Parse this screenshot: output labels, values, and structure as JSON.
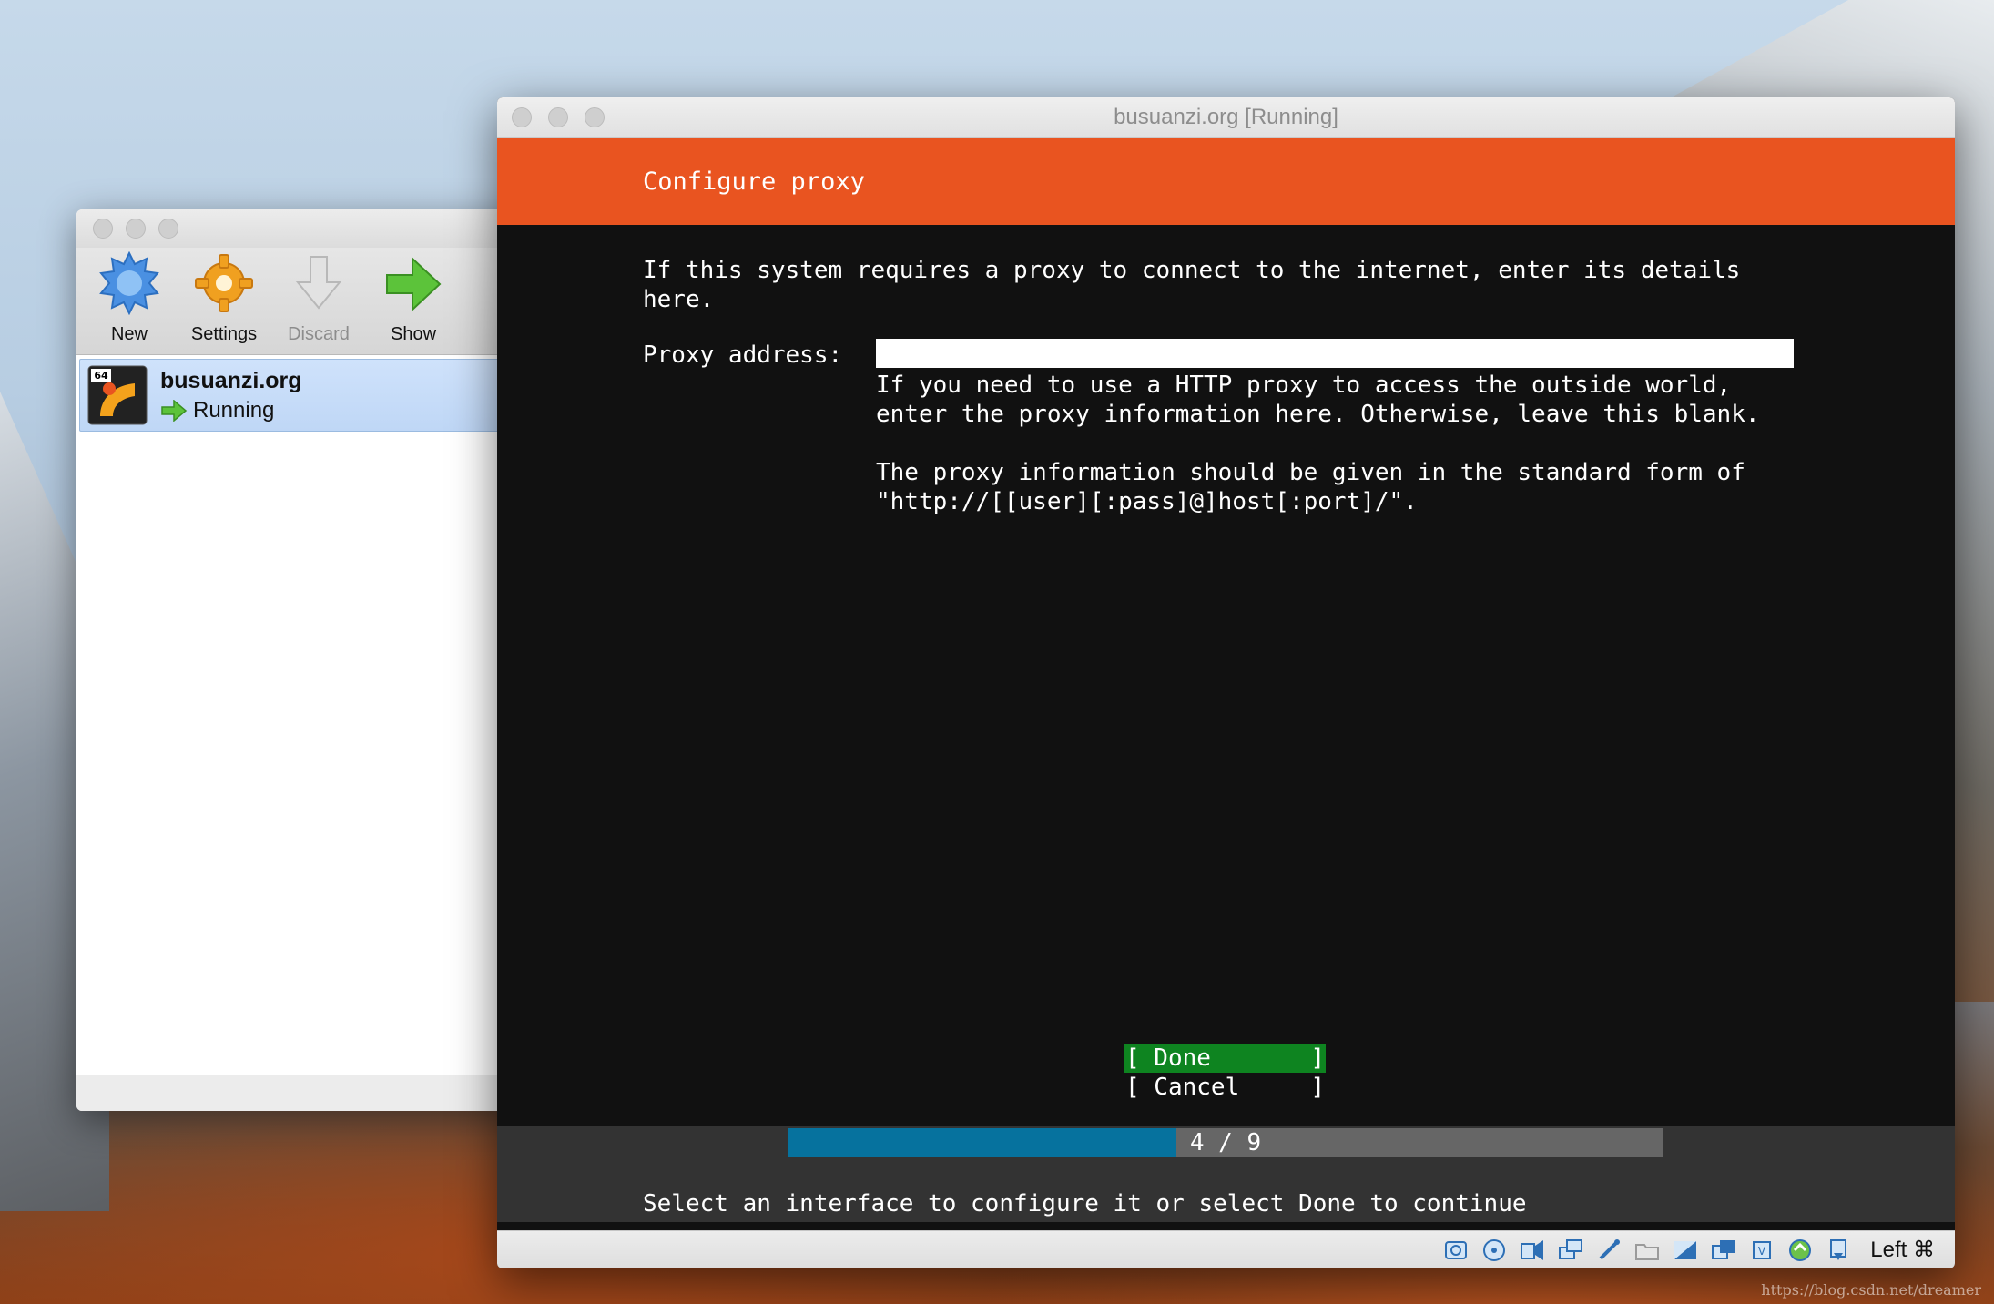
{
  "manager": {
    "toolbar": [
      {
        "label": "New",
        "icon": "new-icon"
      },
      {
        "label": "Settings",
        "icon": "settings-icon"
      },
      {
        "label": "Discard",
        "icon": "discard-icon"
      },
      {
        "label": "Show",
        "icon": "show-icon"
      }
    ],
    "vm": {
      "name": "busuanzi.org",
      "status": "Running",
      "os_badge": "64"
    }
  },
  "vm_window": {
    "title": "busuanzi.org [Running]",
    "screen": {
      "header": "Configure proxy",
      "intro": "If this system requires a proxy to connect to the internet, enter its details\nhere.",
      "proxy_label": "Proxy address:",
      "proxy_value": "",
      "help1": "If you need to use a HTTP proxy to access the outside world,\nenter the proxy information here. Otherwise, leave this blank.",
      "help2": "The proxy information should be given in the standard form of\n\"http://[[user][:pass]@]host[:port]/\".",
      "done_label": "[ Done       ]",
      "cancel_label": "[ Cancel     ]",
      "progress_text": "4 / 9",
      "progress_fraction": 0.444,
      "footer": "Select an interface to configure it or select Done to continue"
    },
    "status_bar": {
      "icons": [
        "hard-disk-icon",
        "optical-disk-icon",
        "audio-icon",
        "network-icon",
        "usb-icon",
        "shared-folder-icon",
        "display-icon",
        "video-capture-icon",
        "cpu-icon",
        "guest-additions-icon",
        "mouse-integration-icon"
      ],
      "host_key": "Left ⌘"
    }
  },
  "watermark": "https://blog.csdn.net/dreamer",
  "colors": {
    "ubuntu_orange": "#e95420",
    "done_green": "#0e8420",
    "progress_blue": "#06729e"
  }
}
